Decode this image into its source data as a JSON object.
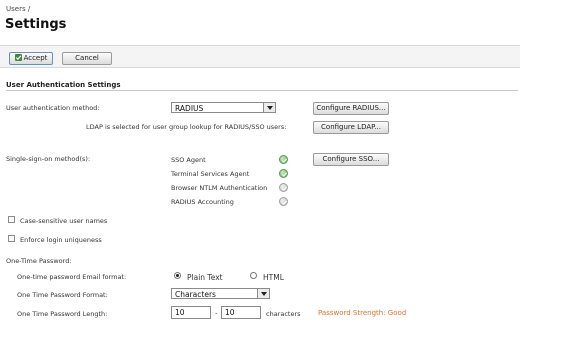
{
  "header": {
    "breadcrumb": "Users /",
    "title": "Settings"
  },
  "toolbar": {
    "accept_label": "Accept",
    "cancel_label": "Cancel"
  },
  "section_title": "User Authentication Settings",
  "auth": {
    "method_label": "User authentication method:",
    "method_value": "RADIUS",
    "configure_radius": "Configure RADIUS...",
    "ldap_note": "LDAP is selected for user group lookup for RADIUS/SSO users:",
    "configure_ldap": "Configure LDAP..."
  },
  "sso": {
    "label": "Single-sign-on method(s):",
    "configure": "Configure SSO...",
    "methods": [
      {
        "name": "SSO Agent",
        "enabled": true
      },
      {
        "name": "Terminal Services Agent",
        "enabled": true
      },
      {
        "name": "Browser NTLM Authentication",
        "enabled": false
      },
      {
        "name": "RADIUS Accounting",
        "enabled": false
      }
    ]
  },
  "options": {
    "case_sensitive": "Case-sensitive user names",
    "login_unique": "Enforce login uniqueness"
  },
  "otp": {
    "heading": "One-Time Password:",
    "email_format_label": "One-time password Email format:",
    "plain_text": "Plain Text",
    "html": "HTML",
    "selected_email_format": "Plain Text",
    "format_label": "One Time Password Format:",
    "format_value": "Characters",
    "length_label": "One Time Password Length:",
    "length_min": "10",
    "length_sep": "-",
    "length_max": "10",
    "length_unit": "characters",
    "strength": "Password Strength: Good"
  },
  "colors": {
    "strength_good": "#e0702a",
    "sso_enabled": "#6fb15f",
    "sso_disabled": "#bdbdbd"
  }
}
